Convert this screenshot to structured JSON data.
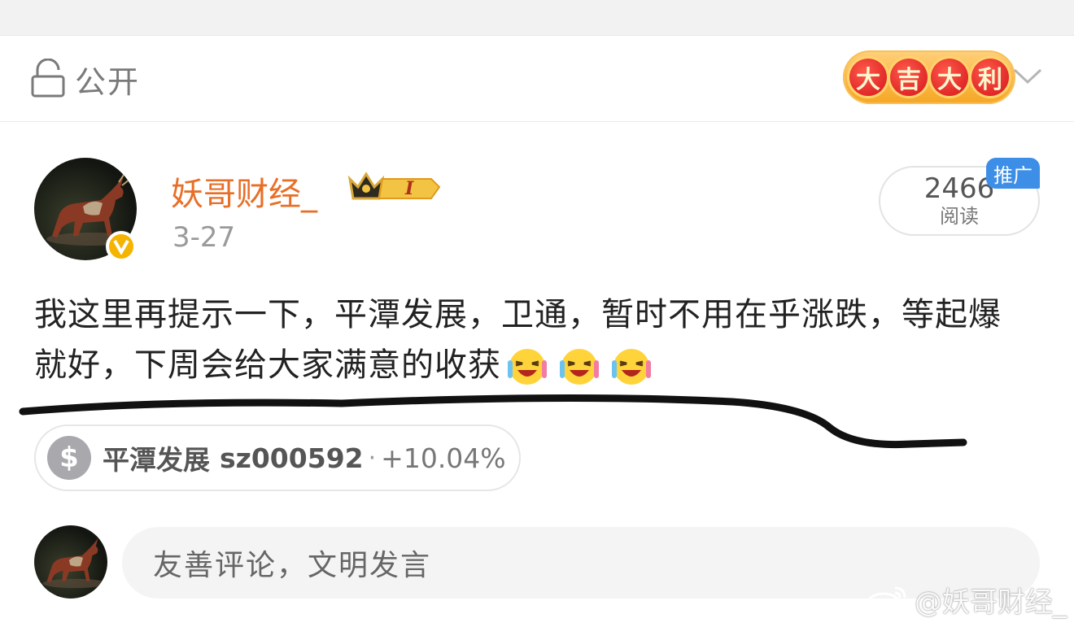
{
  "visibility": {
    "label": "公开",
    "icon": "lock-icon"
  },
  "fortune_badge": {
    "chars": [
      "大",
      "吉",
      "大",
      "利"
    ]
  },
  "author": {
    "name": "妖哥财经_",
    "date": "3-27",
    "level_label": "I",
    "verified": true
  },
  "read_stats": {
    "count": "2466",
    "label": "阅读",
    "promo_tag": "推广"
  },
  "post": {
    "text": "我这里再提示一下，平潭发展，卫通，暂时不用在乎涨跌，等起爆就好，下周会给大家满意的收获",
    "emoji_icons": [
      "laugh-emoji-icon",
      "laugh-emoji-icon",
      "laugh-emoji-icon"
    ]
  },
  "stock": {
    "icon_symbol": "$",
    "name": "平潭发展",
    "code": "sz000592",
    "separator": "·",
    "change": "+10.04%"
  },
  "comment": {
    "placeholder": "友善评论，文明发言"
  },
  "watermark": {
    "text": "@妖哥财经_"
  },
  "colors": {
    "username": "#e86f27",
    "promo": "#3d8ee6",
    "verified": "#f5b400",
    "fortune_red": "#d4141a"
  }
}
